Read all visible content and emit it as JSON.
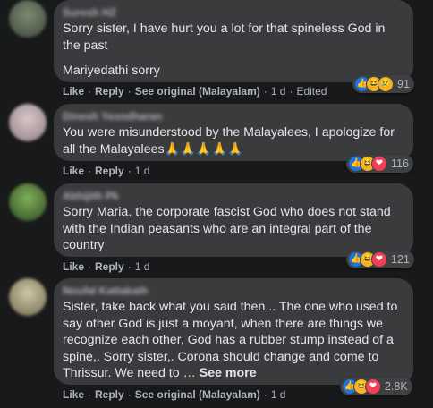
{
  "actions": {
    "like": "Like",
    "reply": "Reply",
    "see_original": "See original (Malayalam)",
    "sep": "·",
    "edited": "Edited"
  },
  "comments": [
    {
      "author": "Suresh HZ",
      "paragraphs": [
        "Sorry sister, I have hurt you a lot for that spineless God in the past",
        "Mariyedathi sorry"
      ],
      "time": "1 d",
      "has_see_original": true,
      "edited": true,
      "reactions": [
        "like",
        "haha",
        "sad"
      ],
      "reaction_count": "91",
      "avatar_color": "#5a6a5a"
    },
    {
      "author": "Dinesh Yesodharan",
      "paragraphs": [
        "You were misunderstood by the Malayalees, I apologize for all the Malayalees🙏🙏🙏🙏🙏"
      ],
      "time": "1 d",
      "has_see_original": false,
      "reactions": [
        "like",
        "haha",
        "love"
      ],
      "reaction_count": "116",
      "avatar_color": "#b9a6a8"
    },
    {
      "author": "Abhijith Pk",
      "paragraphs": [
        "Sorry Maria. the corporate fascist God who does not stand with the Indian peasants who are an integral part of the country"
      ],
      "time": "1 d",
      "has_see_original": false,
      "reactions": [
        "like",
        "haha",
        "love"
      ],
      "reaction_count": "121",
      "avatar_color": "#4f7a3a"
    },
    {
      "author": "Noufal Kattakath",
      "paragraphs": [
        "Sister, take back what you said then,.. The one who used to say other God is just a moyant, when there are things we recognize each other, God has a rubber stump instead of a spine,. Sorry sister,. Corona should change and come to Thrissur. We need to …"
      ],
      "see_more": "See more",
      "time": "1 d",
      "has_see_original": true,
      "reactions": [
        "like",
        "haha",
        "love"
      ],
      "reaction_count": "2.8K",
      "avatar_color": "#a79d7e"
    }
  ]
}
